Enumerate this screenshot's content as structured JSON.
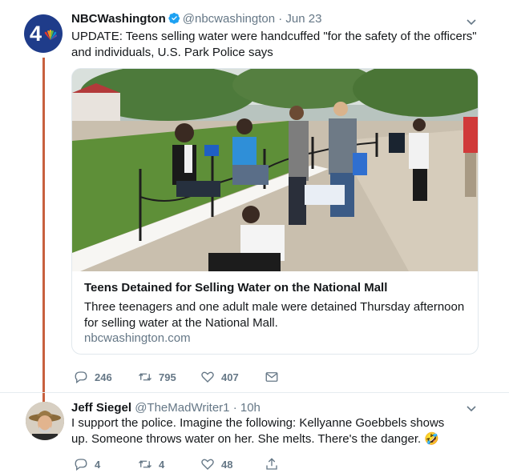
{
  "tweet1": {
    "display_name": "NBCWashington",
    "handle": "@nbcwashington",
    "date": "· Jun 23",
    "text": "UPDATE: Teens selling water were handcuffed \"for the safety of the officers\" and individuals, U.S. Park Police says",
    "avatar_label": "4",
    "card": {
      "title": "Teens Detained for Selling Water on the National Mall",
      "description": "Three teenagers and one adult male were detained Thursday afternoon for selling water at the National Mall.",
      "domain": "nbcwashington.com"
    },
    "actions": {
      "replies": "246",
      "retweets": "795",
      "likes": "407"
    }
  },
  "tweet2": {
    "display_name": "Jeff Siegel",
    "handle": "@TheMadWriter1",
    "date": "· 10h",
    "text": "I support the police. Imagine the following: Kellyanne Goebbels shows up. Someone throws water on her. She melts. There's the danger. 🤣",
    "actions": {
      "replies": "4",
      "retweets": "4",
      "likes": "48"
    }
  },
  "colors": {
    "thread_line": "#c8603f",
    "verified": "#1da1f2",
    "muted": "#657786"
  },
  "icons": [
    "verified-icon",
    "caret-down-icon",
    "reply-icon",
    "retweet-icon",
    "like-icon",
    "message-icon"
  ]
}
